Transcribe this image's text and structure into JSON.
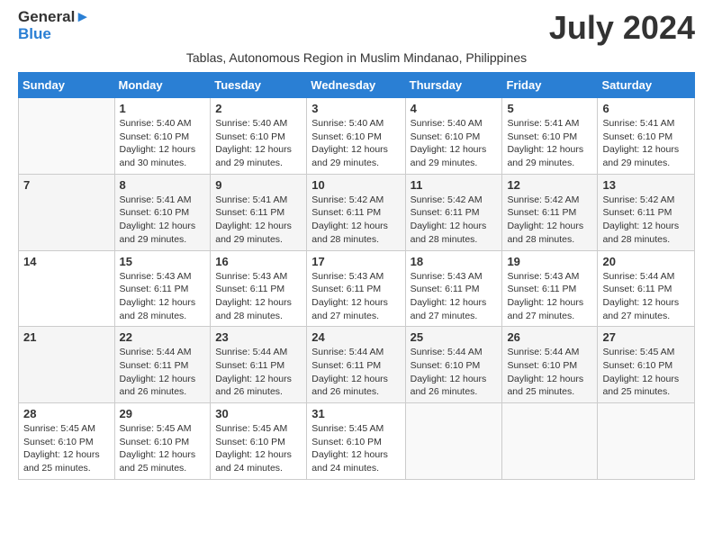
{
  "header": {
    "logo_general": "General",
    "logo_blue": "Blue",
    "month_title": "July 2024",
    "subtitle": "Tablas, Autonomous Region in Muslim Mindanao, Philippines"
  },
  "calendar": {
    "days_of_week": [
      "Sunday",
      "Monday",
      "Tuesday",
      "Wednesday",
      "Thursday",
      "Friday",
      "Saturday"
    ],
    "weeks": [
      [
        {
          "day": "",
          "info": ""
        },
        {
          "day": "1",
          "info": "Sunrise: 5:40 AM\nSunset: 6:10 PM\nDaylight: 12 hours\nand 30 minutes."
        },
        {
          "day": "2",
          "info": "Sunrise: 5:40 AM\nSunset: 6:10 PM\nDaylight: 12 hours\nand 29 minutes."
        },
        {
          "day": "3",
          "info": "Sunrise: 5:40 AM\nSunset: 6:10 PM\nDaylight: 12 hours\nand 29 minutes."
        },
        {
          "day": "4",
          "info": "Sunrise: 5:40 AM\nSunset: 6:10 PM\nDaylight: 12 hours\nand 29 minutes."
        },
        {
          "day": "5",
          "info": "Sunrise: 5:41 AM\nSunset: 6:10 PM\nDaylight: 12 hours\nand 29 minutes."
        },
        {
          "day": "6",
          "info": "Sunrise: 5:41 AM\nSunset: 6:10 PM\nDaylight: 12 hours\nand 29 minutes."
        }
      ],
      [
        {
          "day": "7",
          "info": ""
        },
        {
          "day": "8",
          "info": "Sunrise: 5:41 AM\nSunset: 6:10 PM\nDaylight: 12 hours\nand 29 minutes."
        },
        {
          "day": "9",
          "info": "Sunrise: 5:41 AM\nSunset: 6:11 PM\nDaylight: 12 hours\nand 29 minutes."
        },
        {
          "day": "10",
          "info": "Sunrise: 5:42 AM\nSunset: 6:11 PM\nDaylight: 12 hours\nand 28 minutes."
        },
        {
          "day": "11",
          "info": "Sunrise: 5:42 AM\nSunset: 6:11 PM\nDaylight: 12 hours\nand 28 minutes."
        },
        {
          "day": "12",
          "info": "Sunrise: 5:42 AM\nSunset: 6:11 PM\nDaylight: 12 hours\nand 28 minutes."
        },
        {
          "day": "13",
          "info": "Sunrise: 5:42 AM\nSunset: 6:11 PM\nDaylight: 12 hours\nand 28 minutes."
        }
      ],
      [
        {
          "day": "14",
          "info": ""
        },
        {
          "day": "15",
          "info": "Sunrise: 5:43 AM\nSunset: 6:11 PM\nDaylight: 12 hours\nand 28 minutes."
        },
        {
          "day": "16",
          "info": "Sunrise: 5:43 AM\nSunset: 6:11 PM\nDaylight: 12 hours\nand 28 minutes."
        },
        {
          "day": "17",
          "info": "Sunrise: 5:43 AM\nSunset: 6:11 PM\nDaylight: 12 hours\nand 27 minutes."
        },
        {
          "day": "18",
          "info": "Sunrise: 5:43 AM\nSunset: 6:11 PM\nDaylight: 12 hours\nand 27 minutes."
        },
        {
          "day": "19",
          "info": "Sunrise: 5:43 AM\nSunset: 6:11 PM\nDaylight: 12 hours\nand 27 minutes."
        },
        {
          "day": "20",
          "info": "Sunrise: 5:44 AM\nSunset: 6:11 PM\nDaylight: 12 hours\nand 27 minutes."
        }
      ],
      [
        {
          "day": "21",
          "info": ""
        },
        {
          "day": "22",
          "info": "Sunrise: 5:44 AM\nSunset: 6:11 PM\nDaylight: 12 hours\nand 26 minutes."
        },
        {
          "day": "23",
          "info": "Sunrise: 5:44 AM\nSunset: 6:11 PM\nDaylight: 12 hours\nand 26 minutes."
        },
        {
          "day": "24",
          "info": "Sunrise: 5:44 AM\nSunset: 6:11 PM\nDaylight: 12 hours\nand 26 minutes."
        },
        {
          "day": "25",
          "info": "Sunrise: 5:44 AM\nSunset: 6:10 PM\nDaylight: 12 hours\nand 26 minutes."
        },
        {
          "day": "26",
          "info": "Sunrise: 5:44 AM\nSunset: 6:10 PM\nDaylight: 12 hours\nand 25 minutes."
        },
        {
          "day": "27",
          "info": "Sunrise: 5:45 AM\nSunset: 6:10 PM\nDaylight: 12 hours\nand 25 minutes."
        }
      ],
      [
        {
          "day": "28",
          "info": "Sunrise: 5:45 AM\nSunset: 6:10 PM\nDaylight: 12 hours\nand 25 minutes."
        },
        {
          "day": "29",
          "info": "Sunrise: 5:45 AM\nSunset: 6:10 PM\nDaylight: 12 hours\nand 25 minutes."
        },
        {
          "day": "30",
          "info": "Sunrise: 5:45 AM\nSunset: 6:10 PM\nDaylight: 12 hours\nand 24 minutes."
        },
        {
          "day": "31",
          "info": "Sunrise: 5:45 AM\nSunset: 6:10 PM\nDaylight: 12 hours\nand 24 minutes."
        },
        {
          "day": "",
          "info": ""
        },
        {
          "day": "",
          "info": ""
        },
        {
          "day": "",
          "info": ""
        }
      ]
    ]
  }
}
